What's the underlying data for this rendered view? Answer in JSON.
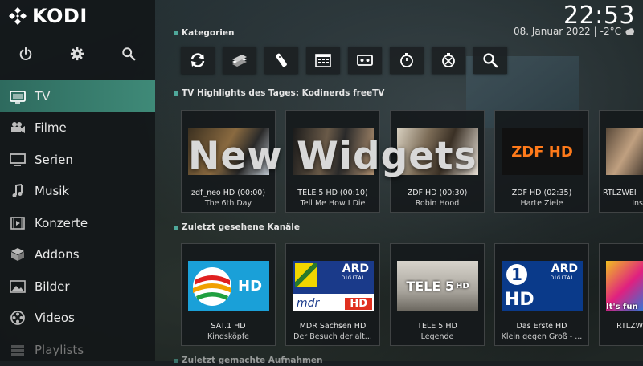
{
  "app": {
    "name": "KODI"
  },
  "clock": {
    "time": "22:53",
    "date": "08. Januar 2022",
    "separator": "|",
    "temperature": "-2°C",
    "weather_icon": "cloud-icon"
  },
  "sidebar": {
    "top_icons": [
      "power-icon",
      "gear-icon",
      "search-icon"
    ],
    "items": [
      {
        "label": "TV",
        "icon": "tv-icon",
        "active": true
      },
      {
        "label": "Filme",
        "icon": "film-camera-icon"
      },
      {
        "label": "Serien",
        "icon": "monitor-icon"
      },
      {
        "label": "Musik",
        "icon": "music-note-icon"
      },
      {
        "label": "Konzerte",
        "icon": "concert-icon"
      },
      {
        "label": "Addons",
        "icon": "boxes-icon"
      },
      {
        "label": "Bilder",
        "icon": "picture-icon"
      },
      {
        "label": "Videos",
        "icon": "film-reel-icon"
      },
      {
        "label": "Playlists",
        "icon": "playlist-icon"
      }
    ]
  },
  "categories": {
    "title": "Kategorien",
    "icons": [
      "refresh-icon",
      "channels-icon",
      "remote-icon",
      "guide-icon",
      "recordings-icon",
      "timers-icon",
      "timer-rules-icon",
      "search-icon"
    ]
  },
  "overlay": {
    "title": "New Widgets"
  },
  "highlights": {
    "title": "TV Highlights des Tages: Kodinerds freeTV",
    "items": [
      {
        "channel": "zdf_neo HD (00:00)",
        "show": "The 6th Day"
      },
      {
        "channel": "TELE 5 HD (00:10)",
        "show": "Tell Me How I Die"
      },
      {
        "channel": "ZDF HD (00:30)",
        "show": "Robin Hood"
      },
      {
        "channel": "ZDF HD (02:35)",
        "show": "Harte Ziele",
        "logo": "ZDF HD"
      },
      {
        "channel": "RTLZWEI",
        "show": "Ins"
      }
    ]
  },
  "recent": {
    "title": "Zuletzt gesehene Kanäle",
    "items": [
      {
        "channel": "SAT.1 HD",
        "show": "Kindsköpfe",
        "logo": "HD"
      },
      {
        "channel": "MDR Sachsen HD",
        "show": "Der Besuch der alt...",
        "logo_top": "ARD",
        "logo_sub": "DIGITAL",
        "logo_bottom": "mdr",
        "logo_hd": "HD"
      },
      {
        "channel": "TELE 5 HD",
        "show": "Legende",
        "logo": "TELE 5",
        "logo_hd": "HD"
      },
      {
        "channel": "Das Erste HD",
        "show": "Klein gegen Groß - ...",
        "logo_top": "ARD",
        "logo_sub": "DIGITAL",
        "logo_hd": "HD"
      },
      {
        "channel": "RTLZW",
        "show": "It's fun"
      }
    ]
  },
  "next_section": {
    "title": "Zuletzt gemachte Aufnahmen"
  }
}
